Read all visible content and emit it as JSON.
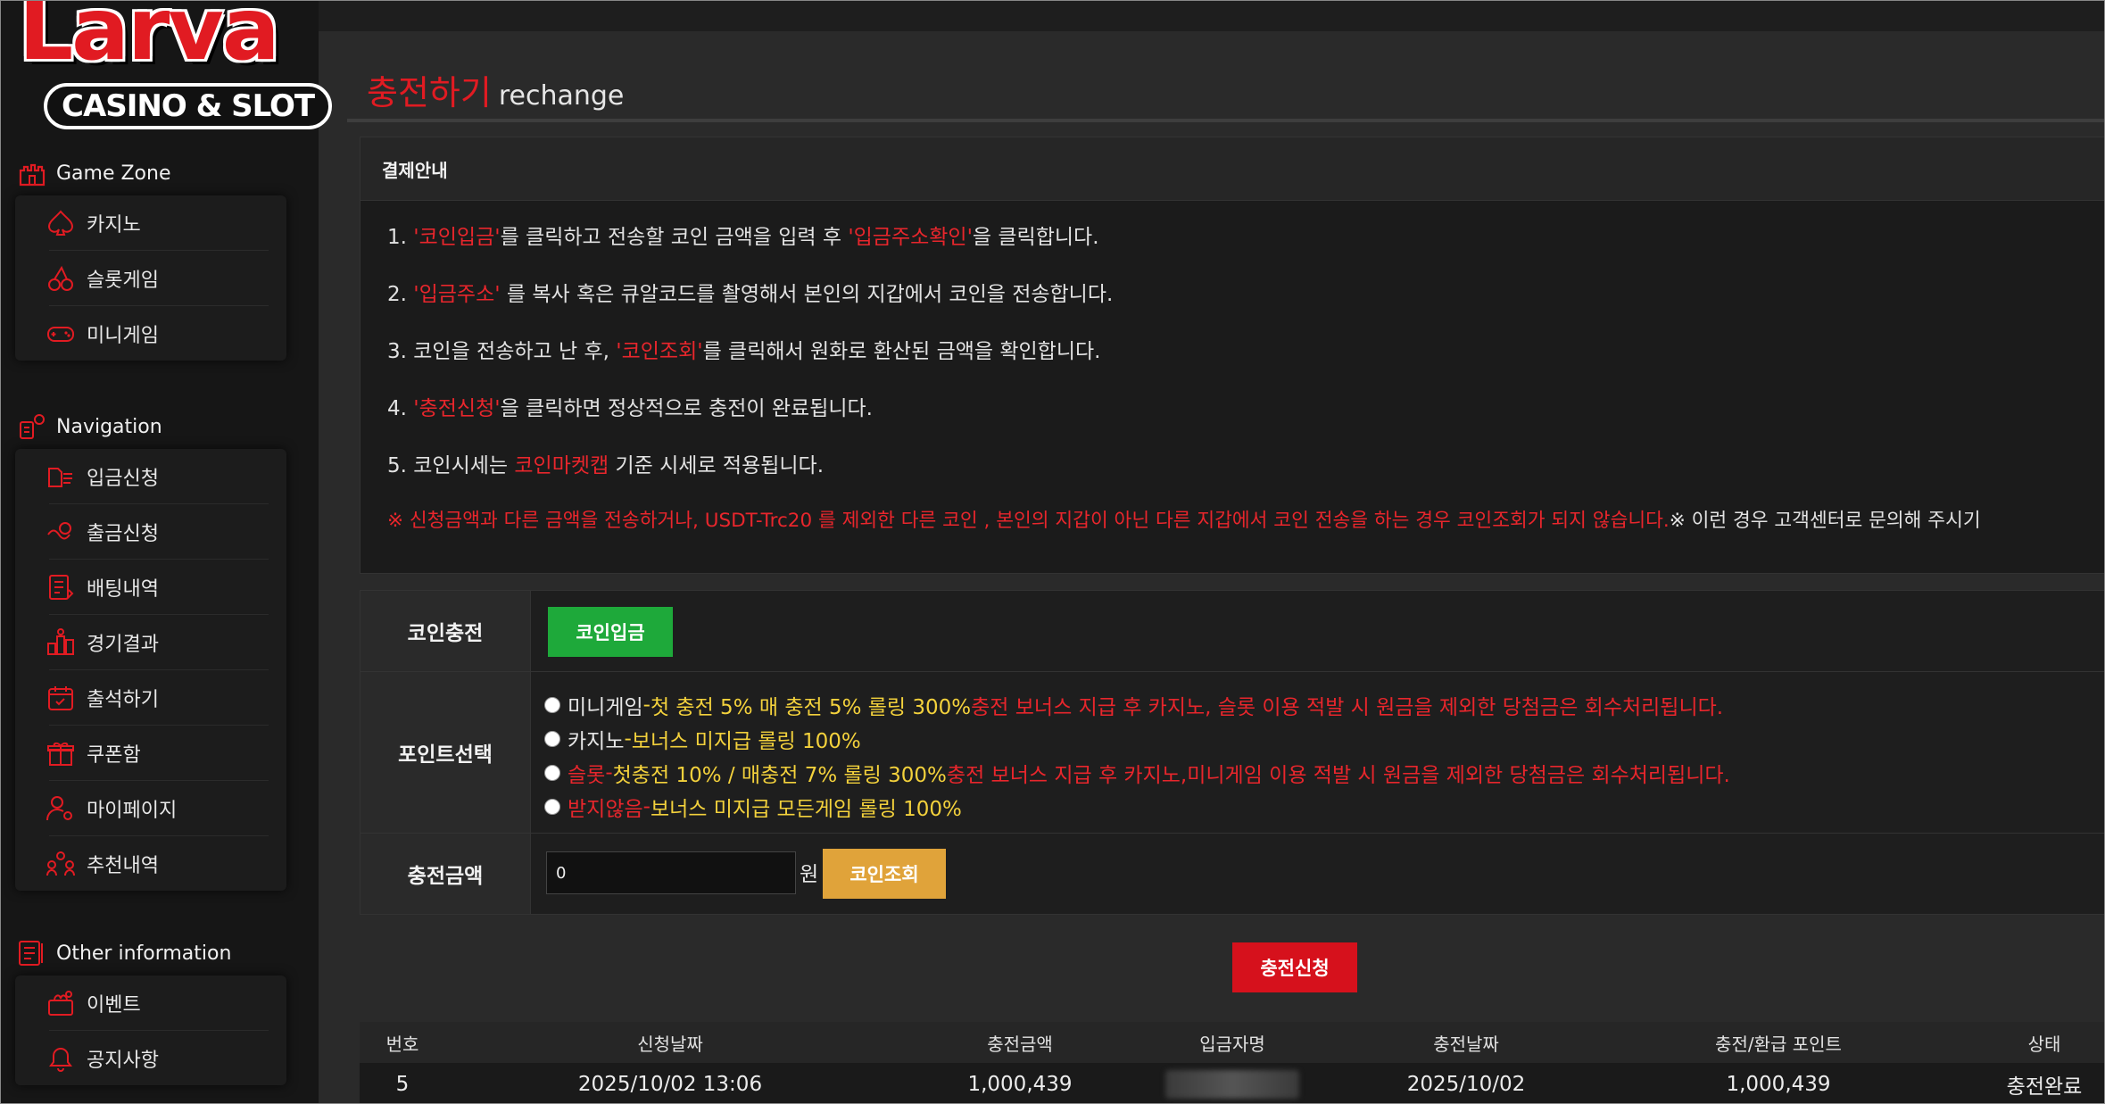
{
  "brand": {
    "logo_top": "Larva",
    "logo_bottom": "CASINO & SLOT"
  },
  "sidebar": {
    "game_zone": {
      "title": "Game Zone",
      "items": [
        {
          "label": "카지노",
          "icon": "spade-icon"
        },
        {
          "label": "슬롯게임",
          "icon": "cherry-icon"
        },
        {
          "label": "미니게임",
          "icon": "gamepad-icon"
        }
      ]
    },
    "navigation": {
      "title": "Navigation",
      "items": [
        {
          "label": "입금신청",
          "icon": "deposit-icon"
        },
        {
          "label": "출금신청",
          "icon": "withdraw-icon"
        },
        {
          "label": "배팅내역",
          "icon": "betting-history-icon"
        },
        {
          "label": "경기결과",
          "icon": "results-icon"
        },
        {
          "label": "출석하기",
          "icon": "calendar-icon"
        },
        {
          "label": "쿠폰함",
          "icon": "gift-icon"
        },
        {
          "label": "마이페이지",
          "icon": "user-gear-icon"
        },
        {
          "label": "추천내역",
          "icon": "referral-icon"
        }
      ]
    },
    "other": {
      "title": "Other information",
      "items": [
        {
          "label": "이벤트",
          "icon": "event-icon"
        },
        {
          "label": "공지사항",
          "icon": "bell-icon"
        }
      ]
    }
  },
  "page": {
    "title": "충전하기",
    "subtitle": "rechange"
  },
  "guide": {
    "title": "결제안내",
    "line1": {
      "a": "1. ",
      "b": "'코인입금'",
      "c": "를 클릭하고 전송할 코인 금액을 입력 후 ",
      "d": "'입금주소확인'",
      "e": "을 클릭합니다."
    },
    "line2": {
      "a": "2. ",
      "b": "'입금주소'",
      "c": " 를 복사 혹은 큐알코드를 촬영해서 본인의 지갑에서 코인을 전송합니다."
    },
    "line3": {
      "a": "3. 코인을 전송하고 난 후, ",
      "b": "'코인조회'",
      "c": "를 클릭해서 원화로 환산된 금액을 확인합니다."
    },
    "line4": {
      "a": "4. ",
      "b": "'충전신청'",
      "c": "을 클릭하면 정상적으로 충전이 완료됩니다."
    },
    "line5": {
      "a": "5. 코인시세는 ",
      "b": "코인마켓캡",
      "c": " 기준 시세로 적용됩니다."
    },
    "warning": {
      "red": "※ 신청금액과 다른 금액을 전송하거나, USDT-Trc20 를 제외한 다른 코인 , 본인의 지갑이 아닌 다른 지갑에서 코인 전송을 하는 경우 코인조회가 되지 않습니다.",
      "white": "※ 이런 경우 고객센터로 문의해 주시기"
    }
  },
  "form": {
    "coin_charge": {
      "label": "코인충전",
      "button": "코인입금"
    },
    "point": {
      "label": "포인트선택",
      "options": [
        {
          "name": "미니게임",
          "sep": " - ",
          "bonus": "첫 충전 5% 매 충전 5% 롤링 300%",
          "note": " 충전 보너스 지급 후 카지노, 슬롯 이용 적발 시 원금을 제외한 당첨금은 회수처리됩니다."
        },
        {
          "name": "카지노",
          "sep": " - ",
          "bonus": "보너스 미지급 롤링 100%",
          "note": ""
        },
        {
          "name": "슬롯",
          "sep": " - ",
          "bonus": "첫충전 10% / 매충전 7% 롤링 300%",
          "note": " 충전 보너스 지급 후 카지노,미니게임 이용 적발 시 원금을 제외한 당첨금은 회수처리됩니다."
        },
        {
          "name": "받지않음",
          "sep": " - ",
          "bonus": "보너스 미지급 모든게임 롤링 100%",
          "note": ""
        }
      ]
    },
    "amount": {
      "label": "충전금액",
      "value": "0",
      "unit": "원",
      "button": "코인조회"
    },
    "submit": "충전신청"
  },
  "table": {
    "headers": [
      "번호",
      "신청날짜",
      "충전금액",
      "입금자명",
      "충전날짜",
      "충전/환급 포인트",
      "상태"
    ],
    "rows": [
      [
        "5",
        "2025/10/02 13:06",
        "1,000,439",
        "",
        "2025/10/02",
        "1,000,439",
        "충전완료"
      ]
    ]
  },
  "colors": {
    "accent_red": "#e11b22",
    "highlight_yellow": "#f3d13c",
    "button_green": "#1ea93a",
    "button_gold": "#e0a33a",
    "button_red": "#d6111c"
  }
}
